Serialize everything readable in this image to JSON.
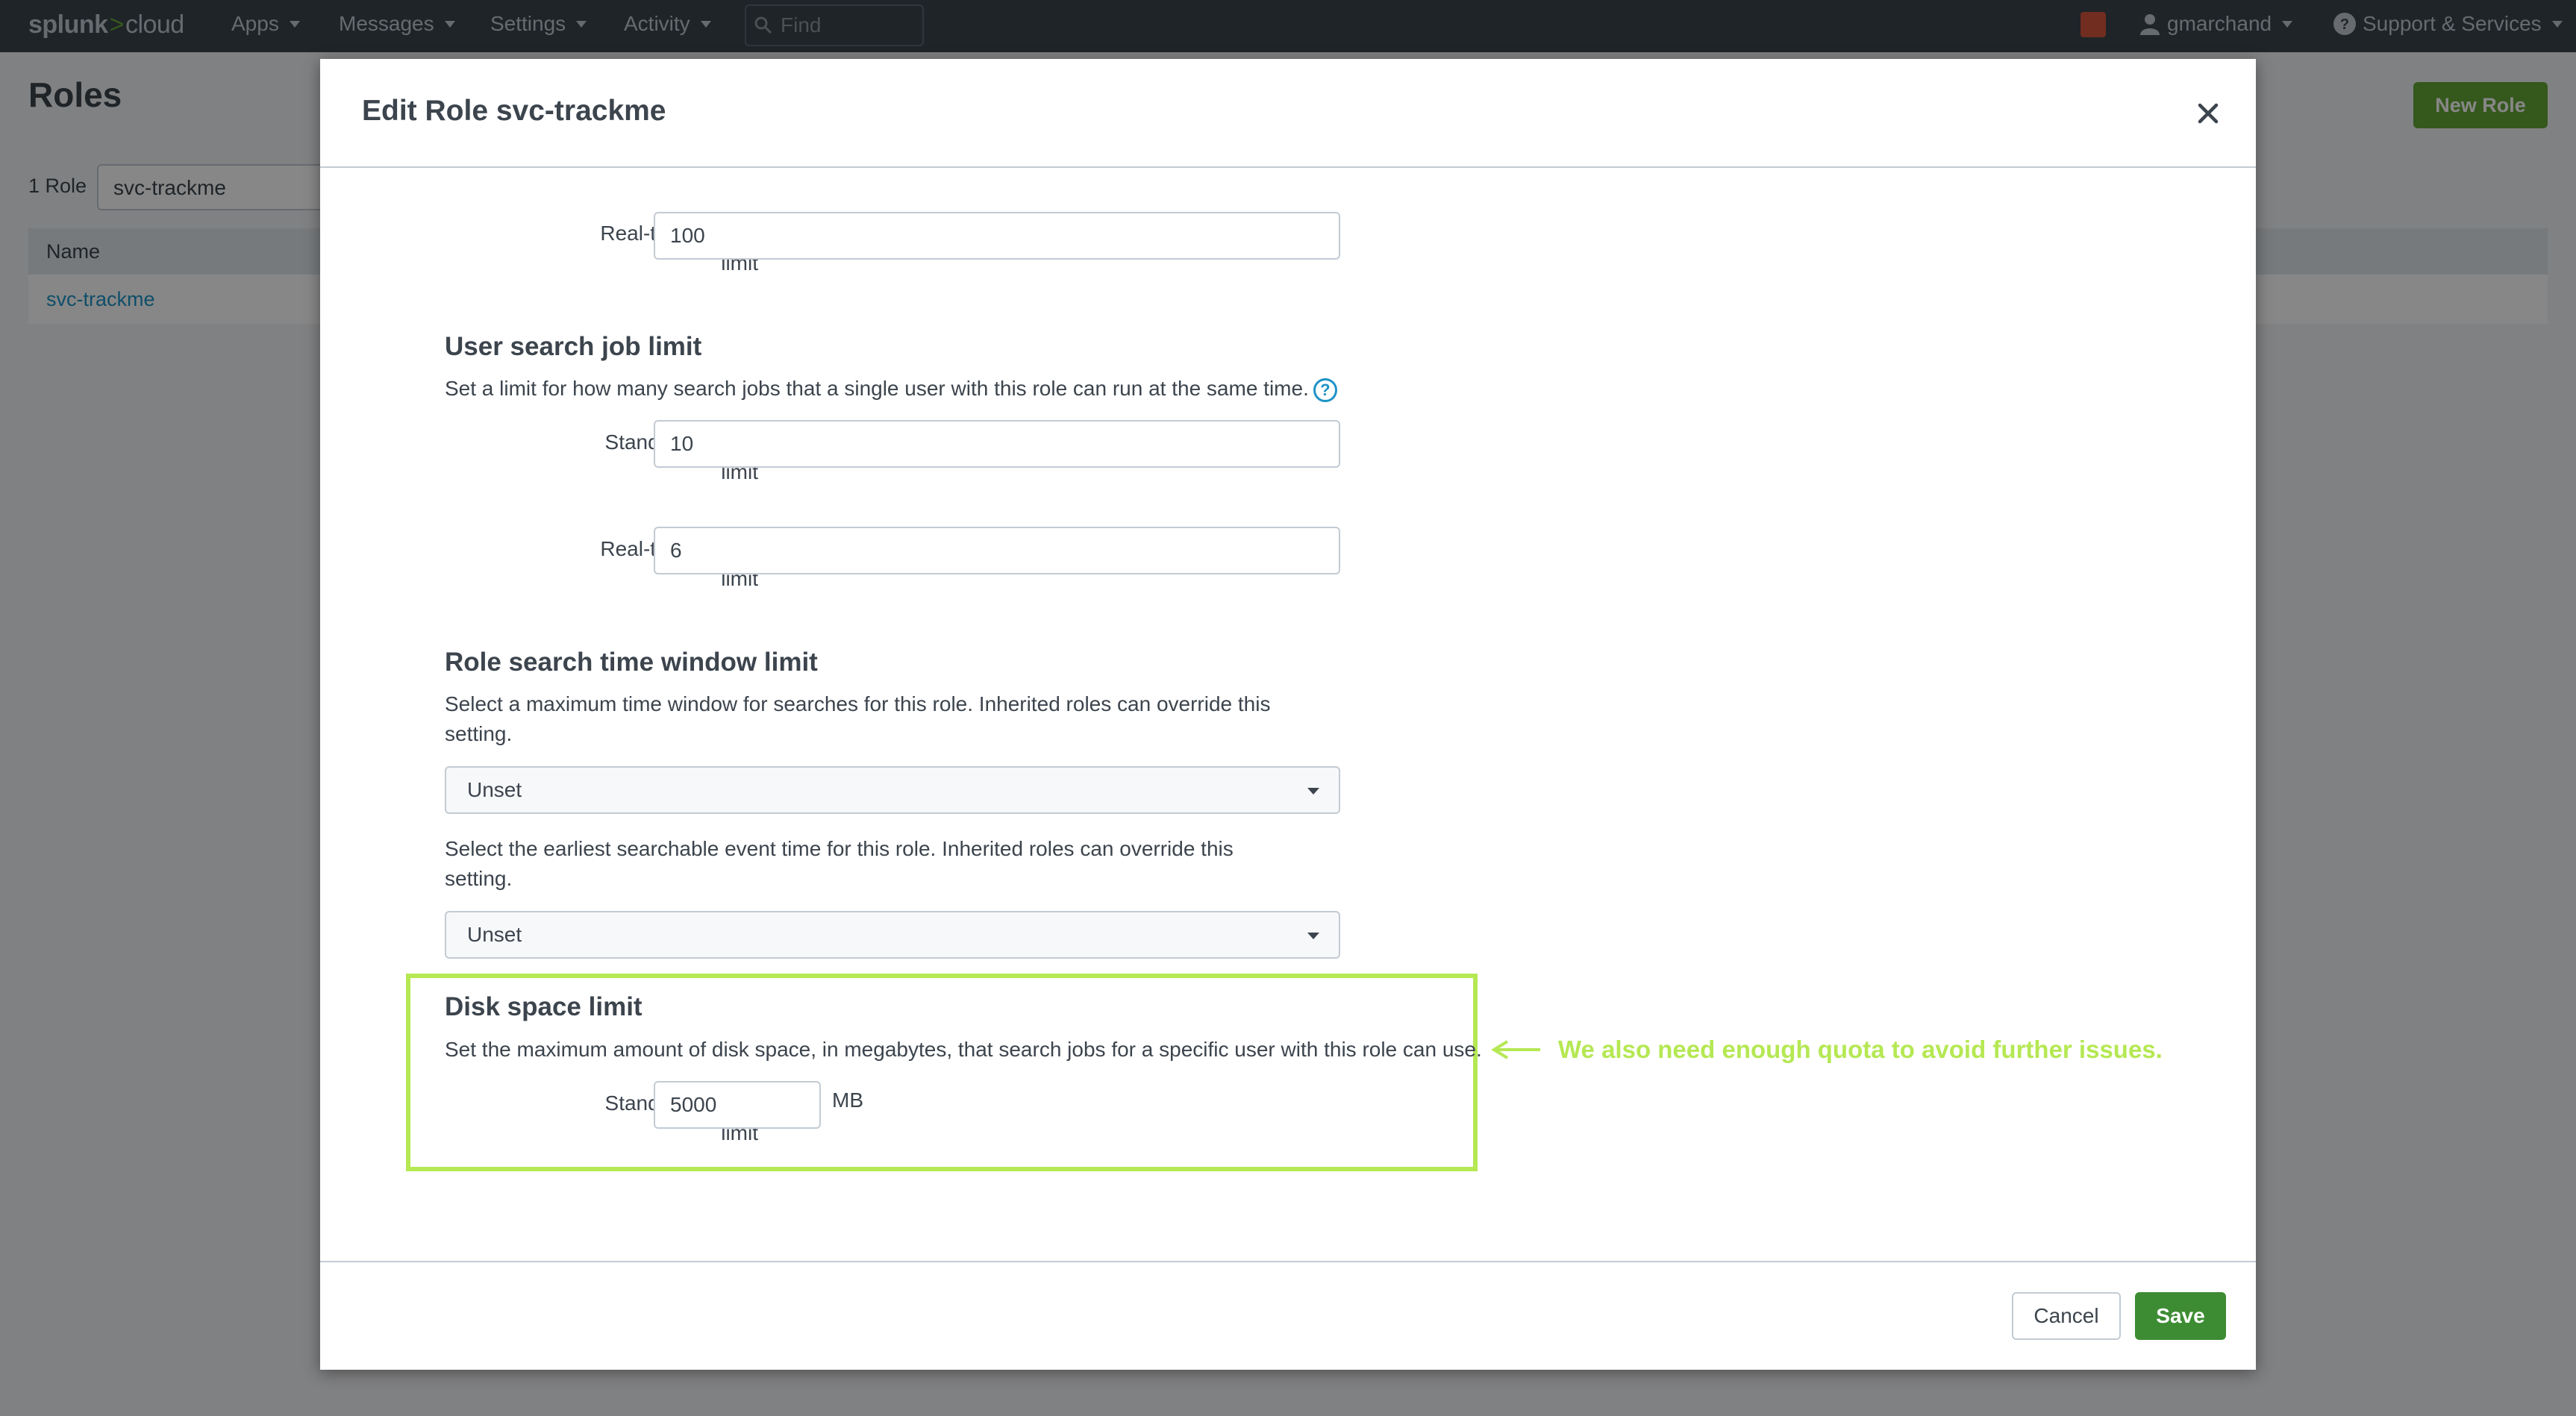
{
  "topbar": {
    "logo_brand": "splunk",
    "logo_sep": ">",
    "logo_product": "cloud",
    "nav": [
      "Apps",
      "Messages",
      "Settings",
      "Activity"
    ],
    "find_placeholder": "Find",
    "user": "gmarchand",
    "support": "Support & Services"
  },
  "page": {
    "title": "Roles",
    "count": "1 Role",
    "filter_value": "svc-trackme",
    "column_name": "Name",
    "row_name": "svc-trackme",
    "new_role": "New Role"
  },
  "modal": {
    "title": "Edit Role svc-trackme",
    "rt_search_limit_label": "Real-time search limit",
    "rt_search_limit_value": "100",
    "user_job": {
      "heading": "User search job limit",
      "description": "Set a limit for how many search jobs that a single user with this role can run at the same time.",
      "standard_label": "Standard search limit",
      "standard_value": "10",
      "realtime_label": "Real-time search limit",
      "realtime_value": "6"
    },
    "time_window": {
      "heading": "Role search time window limit",
      "description1": "Select a maximum time window for searches for this role. Inherited roles can override this setting.",
      "select1": "Unset",
      "description2": "Select the earliest searchable event time for this role. Inherited roles can override this setting.",
      "select2": "Unset"
    },
    "disk": {
      "heading": "Disk space limit",
      "description": "Set the maximum amount of disk space, in megabytes, that search jobs for a specific user with this role can use.",
      "standard_label": "Standard search limit",
      "standard_value": "5000",
      "unit": "MB"
    },
    "cancel": "Cancel",
    "save": "Save"
  },
  "annotation": {
    "text": "We also need enough quota to avoid further issues.",
    "color": "#b5e853"
  }
}
